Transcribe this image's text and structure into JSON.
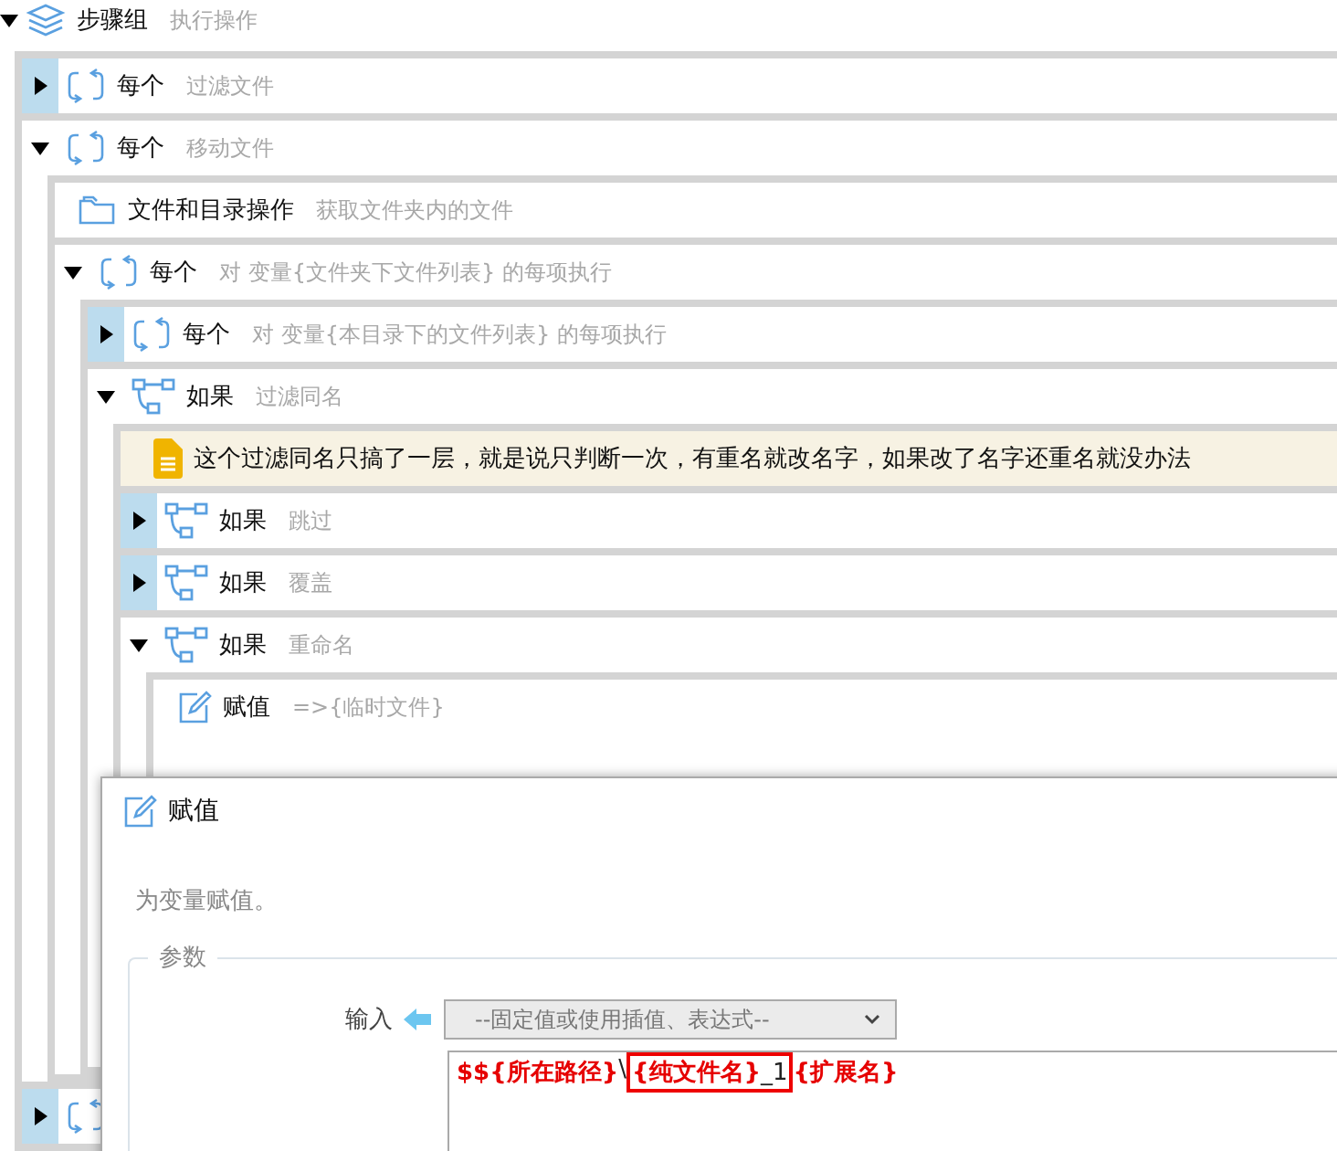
{
  "tree": {
    "kind": "group",
    "title": "步骤组",
    "desc": "执行操作",
    "expanded": true,
    "children": [
      {
        "kind": "loop",
        "title": "每个",
        "desc": "过滤文件",
        "expanded": false
      },
      {
        "kind": "loop",
        "title": "每个",
        "desc": "移动文件",
        "expanded": true,
        "children": [
          {
            "kind": "folder",
            "title": "文件和目录操作",
            "desc": "获取文件夹内的文件"
          },
          {
            "kind": "loop",
            "title": "每个",
            "desc": "对 变量{文件夹下文件列表} 的每项执行",
            "expanded": true,
            "children": [
              {
                "kind": "loop",
                "title": "每个",
                "desc": "对 变量{本目录下的文件列表} 的每项执行",
                "expanded": false
              },
              {
                "kind": "if",
                "title": "如果",
                "desc": "过滤同名",
                "expanded": true,
                "children": [
                  {
                    "kind": "note",
                    "title": "这个过滤同名只搞了一层，就是说只判断一次，有重名就改名字，如果改了名字还重名就没办法"
                  },
                  {
                    "kind": "if",
                    "title": "如果",
                    "desc": "跳过",
                    "expanded": false
                  },
                  {
                    "kind": "if",
                    "title": "如果",
                    "desc": "覆盖",
                    "expanded": false
                  },
                  {
                    "kind": "if",
                    "title": "如果",
                    "desc": "重命名",
                    "expanded": true,
                    "children": [
                      {
                        "kind": "assign",
                        "title": "赋值",
                        "desc": "=>{临时文件}"
                      }
                    ]
                  }
                ]
              }
            ]
          }
        ]
      },
      {
        "kind": "loop",
        "expanded": false
      }
    ]
  },
  "dialog": {
    "title": "赋值",
    "description": "为变量赋值。",
    "legend": "参数",
    "field": {
      "label": "输入",
      "placeholder": "--固定值或使用插值、表达式--",
      "tokens": [
        {
          "text": "$${所在路径}",
          "kind": "var",
          "highlighted": false
        },
        {
          "text": "\\",
          "kind": "text",
          "highlighted": false
        },
        {
          "text": "{纯文件名}",
          "kind": "var",
          "highlighted": true
        },
        {
          "text": "_1",
          "kind": "text",
          "highlighted": true
        },
        {
          "text": "{扩展名}",
          "kind": "var",
          "highlighted": false
        }
      ]
    }
  }
}
